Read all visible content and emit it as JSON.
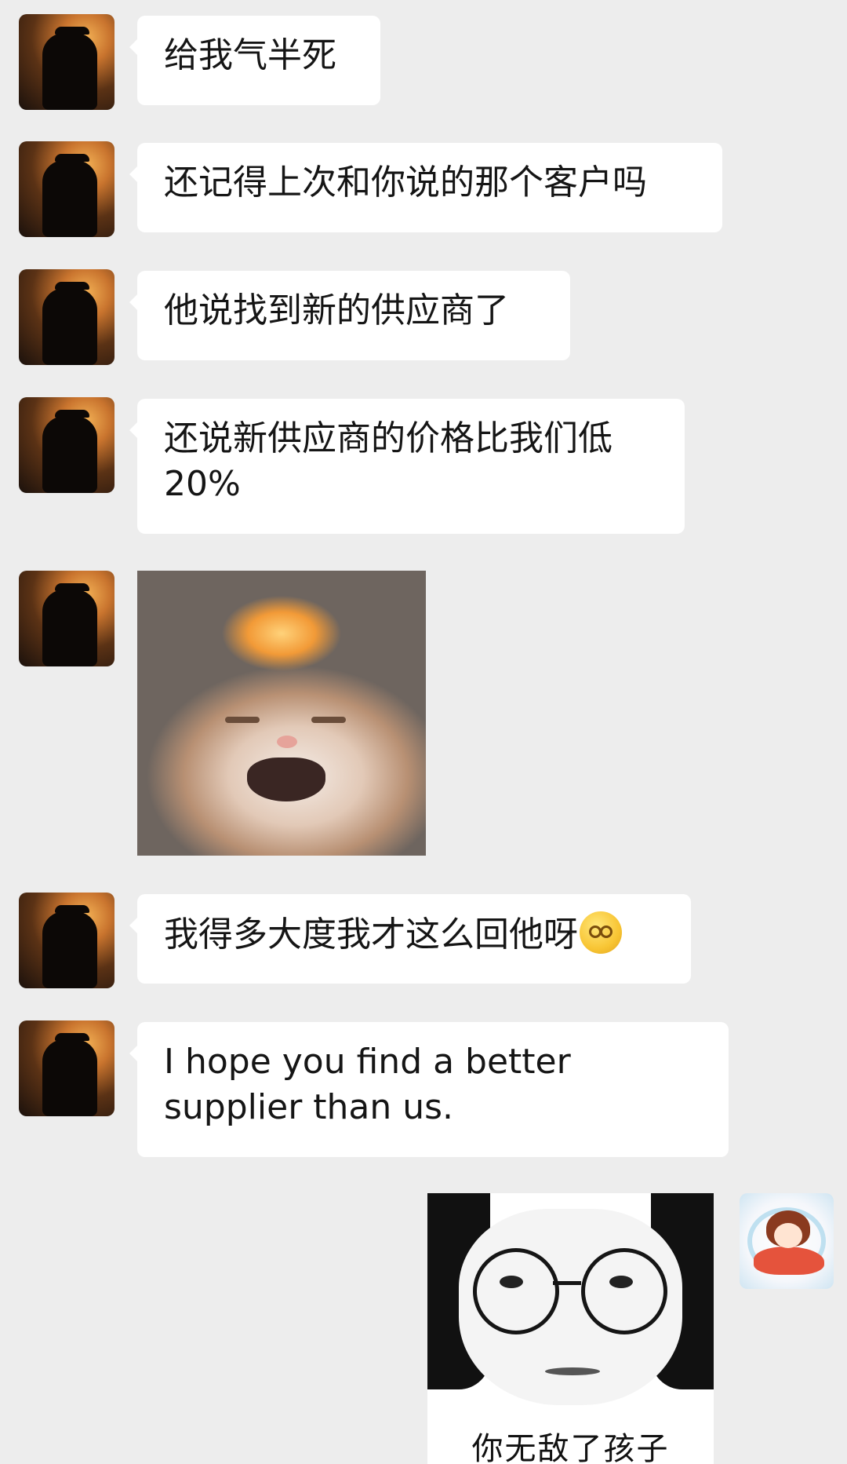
{
  "messages": [
    {
      "text": "给我气半死"
    },
    {
      "text": "还记得上次和你说的那个客户吗"
    },
    {
      "text": "他说找到新的供应商了"
    },
    {
      "text": "还说新供应商的价格比我们低20%"
    },
    {
      "text": "我得多大度我才这么回他呀"
    },
    {
      "text": "I hope you find a better supplier than us."
    }
  ],
  "stickers": {
    "cat": {
      "semantic": "angry-cat-explosion-sticker"
    },
    "face": {
      "caption": "你无敌了孩子"
    }
  },
  "icons": {
    "contact_avatar": "silhouette-sunset-avatar",
    "my_avatar": "girl-on-fish-avatar",
    "emoji": "dizzy-face-emoji"
  },
  "colors": {
    "background": "#ededed",
    "bubble": "#ffffff",
    "text": "#151515"
  }
}
